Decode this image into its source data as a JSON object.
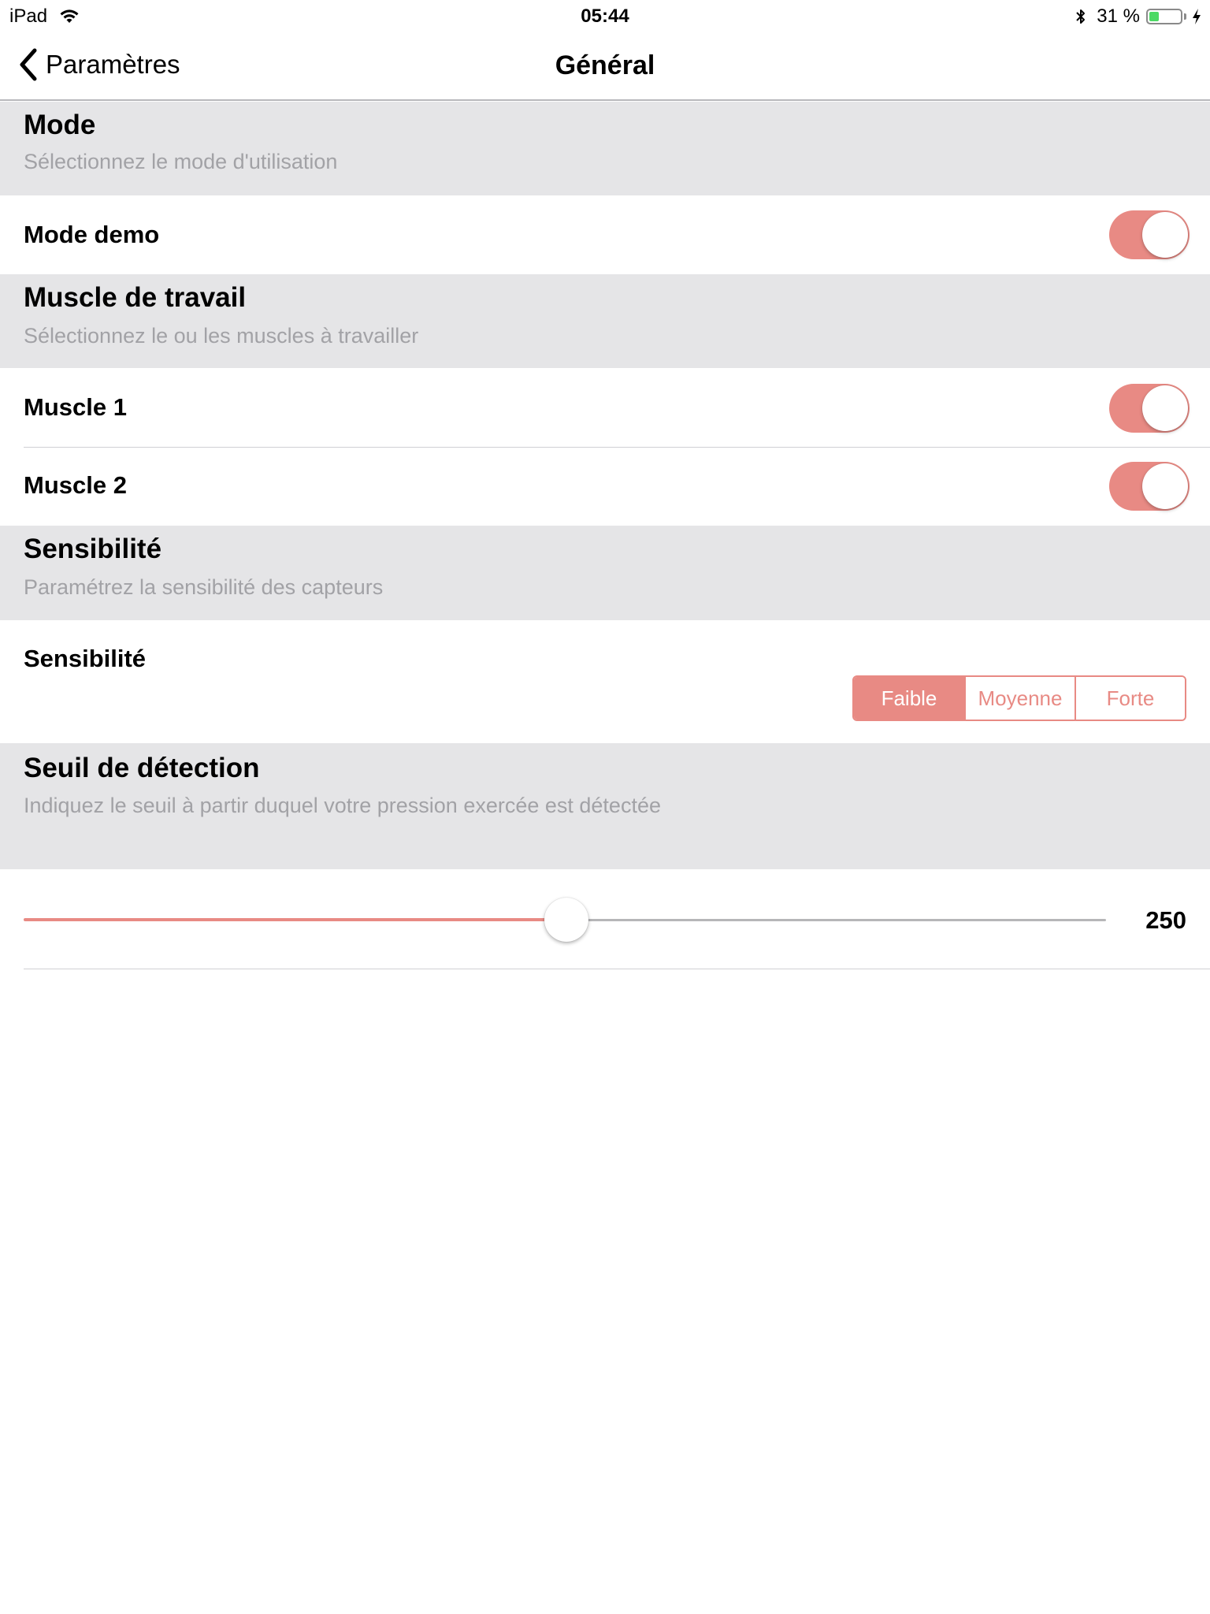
{
  "status_bar": {
    "device": "iPad",
    "time": "05:44",
    "battery_percent": "31 %",
    "battery_level": 0.31
  },
  "nav": {
    "back_label": "Paramètres",
    "title": "Général"
  },
  "sections": {
    "mode": {
      "title": "Mode",
      "subtitle": "Sélectionnez le mode d'utilisation",
      "rows": [
        {
          "label": "Mode demo",
          "on": true
        }
      ]
    },
    "muscle": {
      "title": "Muscle de travail",
      "subtitle": "Sélectionnez le ou les muscles à travailler",
      "rows": [
        {
          "label": "Muscle 1",
          "on": true
        },
        {
          "label": "Muscle 2",
          "on": true
        }
      ]
    },
    "sensibilite": {
      "title": "Sensibilité",
      "subtitle": "Paramétrez la sensibilité des capteurs",
      "row_label": "Sensibilité",
      "options": [
        "Faible",
        "Moyenne",
        "Forte"
      ],
      "selected": "Faible"
    },
    "seuil": {
      "title": "Seuil de détection",
      "subtitle": "Indiquez le seuil à partir duquel votre pression exercée est détectée",
      "value": "250",
      "fraction": 0.5
    }
  },
  "colors": {
    "accent": "#e88a84",
    "header_bg": "#e5e5e7",
    "subtitle": "#a2a2a6",
    "battery": "#4cd964"
  }
}
